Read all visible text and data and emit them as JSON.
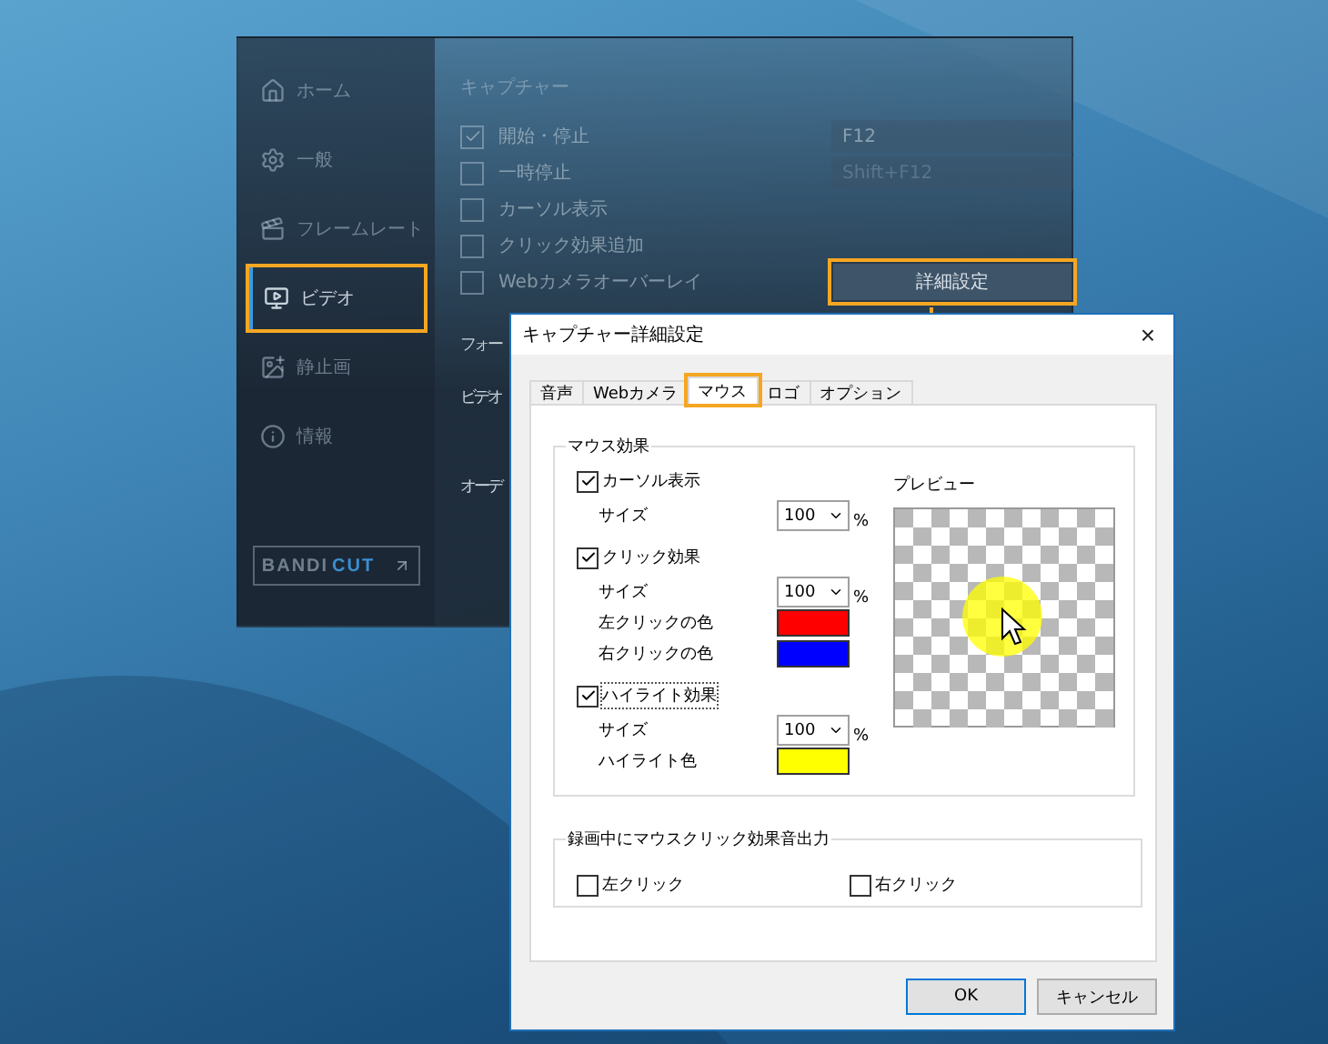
{
  "main_window": {
    "sidebar": [
      {
        "label": "ホーム",
        "selected": false,
        "highlighted": false
      },
      {
        "label": "一般",
        "selected": false,
        "highlighted": false
      },
      {
        "label": "フレームレート",
        "selected": false,
        "highlighted": false
      },
      {
        "label": "ビデオ",
        "selected": true,
        "highlighted": true
      },
      {
        "label": "静止画",
        "selected": false,
        "highlighted": false
      },
      {
        "label": "情報",
        "selected": false,
        "highlighted": false
      }
    ],
    "bandicut": {
      "brand": "BANDI",
      "accent": "CUT"
    },
    "section_title": "キャプチャー",
    "options": [
      {
        "label": "開始・停止",
        "checked": true,
        "hotkey": "F12"
      },
      {
        "label": "一時停止",
        "checked": false,
        "hotkey": "Shift+F12"
      },
      {
        "label": "カーソル表示",
        "checked": false
      },
      {
        "label": "クリック効果追加",
        "checked": false
      },
      {
        "label": "Webカメラオーバーレイ",
        "checked": false
      }
    ],
    "detail_button": {
      "label": "詳細設定",
      "highlighted": true
    },
    "cut_labels": [
      "フォー",
      "ビデオ",
      "オーデ"
    ]
  },
  "dialog": {
    "title": "キャプチャー詳細設定",
    "close": "×",
    "tabs": [
      {
        "label": "音声",
        "selected": false,
        "highlighted": false
      },
      {
        "label": "Webカメラ",
        "selected": false,
        "highlighted": false
      },
      {
        "label": "マウス",
        "selected": true,
        "highlighted": true
      },
      {
        "label": "ロゴ",
        "selected": false,
        "highlighted": false
      },
      {
        "label": "オプション",
        "selected": false,
        "highlighted": false
      }
    ],
    "mouse_effects": {
      "title": "マウス効果",
      "effects": [
        {
          "label": "カーソル表示",
          "checked": true,
          "size_label": "サイズ",
          "size": "100",
          "unit": "%"
        },
        {
          "label": "クリック効果",
          "checked": true,
          "size_label": "サイズ",
          "size": "100",
          "unit": "%",
          "colors": [
            {
              "label": "左クリックの色",
              "color": "#ff0000"
            },
            {
              "label": "右クリックの色",
              "color": "#0000ff"
            }
          ]
        },
        {
          "label": "ハイライト効果",
          "checked": true,
          "focused": true,
          "size_label": "サイズ",
          "size": "100",
          "unit": "%",
          "colors": [
            {
              "label": "ハイライト色",
              "color": "#ffff00"
            }
          ]
        }
      ],
      "preview_label": "プレビュー"
    },
    "sound": {
      "title": "録画中にマウスクリック効果音出力",
      "options": [
        {
          "label": "左クリック",
          "checked": false
        },
        {
          "label": "右クリック",
          "checked": false
        }
      ]
    },
    "buttons": [
      {
        "label": "OK",
        "default": true
      },
      {
        "label": "キャンセル",
        "default": false
      }
    ]
  }
}
